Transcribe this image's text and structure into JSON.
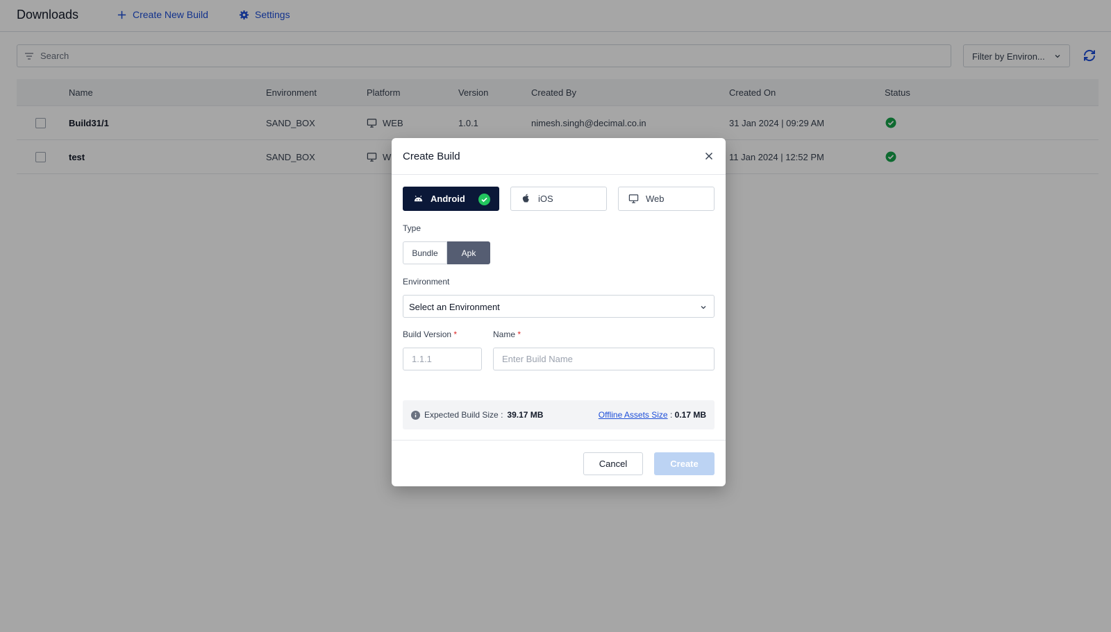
{
  "header": {
    "title": "Downloads",
    "create_label": "Create New Build",
    "settings_label": "Settings"
  },
  "search": {
    "placeholder": "Search"
  },
  "filter": {
    "value": "Filter by Environ..."
  },
  "table": {
    "columns": [
      "Name",
      "Environment",
      "Platform",
      "Version",
      "Created By",
      "Created On",
      "Status"
    ],
    "rows": [
      {
        "name": "Build31/1",
        "environment": "SAND_BOX",
        "platform": "WEB",
        "version": "1.0.1",
        "created_by": "nimesh.singh@decimal.co.in",
        "created_on": "31 Jan 2024 | 09:29 AM",
        "status": "success"
      },
      {
        "name": "test",
        "environment": "SAND_BOX",
        "platform": "W",
        "version": "",
        "created_by": "",
        "created_on": "11 Jan 2024 | 12:52 PM",
        "status": "success"
      }
    ]
  },
  "modal": {
    "title": "Create Build",
    "platforms": [
      {
        "label": "Android",
        "selected": true
      },
      {
        "label": "iOS",
        "selected": false
      },
      {
        "label": "Web",
        "selected": false
      }
    ],
    "type_label": "Type",
    "type_options": [
      "Bundle",
      "Apk"
    ],
    "type_selected": "Apk",
    "environment_label": "Environment",
    "environment_value": "Select an Environment",
    "build_version_label": "Build Version",
    "build_version_placeholder": "1.1.1",
    "name_label": "Name",
    "name_placeholder": "Enter Build Name",
    "required_mark": "*",
    "expected_size_label": "Expected Build Size :",
    "expected_size_value": "39.17 MB",
    "offline_assets_label": "Offline Assets Size",
    "offline_assets_sep": ":",
    "offline_assets_value": "0.17 MB",
    "cancel_label": "Cancel",
    "create_label": "Create"
  },
  "colors": {
    "accent": "#1d4ed8",
    "selected_platform_bg": "#0b1838",
    "success": "#16a34a",
    "apk_selected_bg": "#555d72",
    "create_disabled_bg": "#bcd3f3"
  }
}
